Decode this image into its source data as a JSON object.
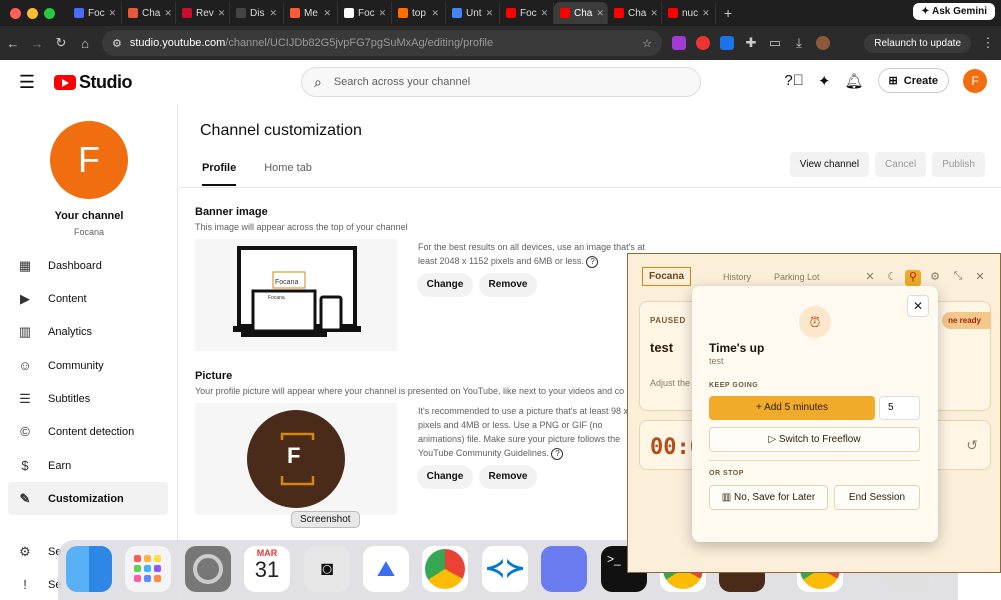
{
  "browser": {
    "tabs": [
      {
        "label": "Foc",
        "color": "#4a6cf7"
      },
      {
        "label": "Cha",
        "color": "#e8593a"
      },
      {
        "label": "Rev",
        "color": "#c8102e"
      },
      {
        "label": "Dis",
        "color": "#444444"
      },
      {
        "label": "Me",
        "color": "#ff5a36"
      },
      {
        "label": "Foc",
        "color": "#ffffff"
      },
      {
        "label": "top",
        "color": "#ff6f00"
      },
      {
        "label": "Unt",
        "color": "#4285f4"
      },
      {
        "label": "Foc",
        "color": "#ff0000"
      },
      {
        "label": "Cha",
        "color": "#ff0000"
      },
      {
        "label": "Cha",
        "color": "#ff0000"
      },
      {
        "label": "nuc",
        "color": "#ff0000"
      }
    ],
    "active_tab": 9,
    "new_tab_label": "+",
    "gemini_label": "Ask Gemini",
    "url_host": "studio.youtube.com",
    "url_path": "/channel/UCIJDb82G5jvpFG7pgSuMxAg/editing/profile",
    "relaunch_label": "Relaunch to update"
  },
  "header": {
    "studio_label": "Studio",
    "search_placeholder": "Search across your channel",
    "create_label": "Create",
    "avatar_letter": "F"
  },
  "sidebar": {
    "avatar_letter": "F",
    "title": "Your channel",
    "channel_name": "Focana",
    "items": [
      {
        "label": "Dashboard",
        "icon": "▦"
      },
      {
        "label": "Content",
        "icon": "▶"
      },
      {
        "label": "Analytics",
        "icon": "▥"
      },
      {
        "label": "Community",
        "icon": "☺"
      },
      {
        "label": "Subtitles",
        "icon": "☰"
      },
      {
        "label": "Content detection",
        "icon": "©"
      },
      {
        "label": "Earn",
        "icon": "$"
      },
      {
        "label": "Customization",
        "icon": "✎"
      }
    ],
    "bottom_items": [
      {
        "label": "Se",
        "icon": "⚙"
      },
      {
        "label": "Se",
        "icon": "!"
      }
    ]
  },
  "main": {
    "title": "Channel customization",
    "tabs": [
      "Profile",
      "Home tab"
    ],
    "view_channel": "View channel",
    "cancel": "Cancel",
    "publish": "Publish",
    "banner": {
      "title": "Banner image",
      "desc": "This image will appear across the top of your channel",
      "hint": "For the best results on all devices, use an image that's at least 2048 x 1152 pixels and 6MB or less.",
      "brand": "Focana",
      "change": "Change",
      "remove": "Remove"
    },
    "picture": {
      "title": "Picture",
      "desc": "Your profile picture will appear where your channel is presented on YouTube, like next to your videos and co",
      "hint": "It's recommended to use a picture that's at least 98 x pixels and 4MB or less. Use a PNG or GIF (no animations) file. Make sure your picture follows the YouTube Community Guidelines.",
      "letter": "F",
      "change": "Change",
      "remove": "Remove"
    }
  },
  "dock": {
    "tooltip": "Screenshot",
    "calendar_month": "MAR",
    "calendar_day": "31"
  },
  "focana": {
    "logo": "Focana",
    "nav": [
      "History",
      "Parking Lot"
    ],
    "paused_label": "PAUSED",
    "ready_label": "ne ready",
    "task": "test",
    "adjust_label": "Adjust the",
    "timer": "00:0",
    "modal": {
      "close": "✕",
      "title": "Time's up",
      "subtitle": "test",
      "keep_going": "KEEP GOING",
      "add_label": "+ Add 5 minutes",
      "minutes_value": "5",
      "freeflow_label": "Switch to Freeflow",
      "or_stop": "OR STOP",
      "save_later": "No, Save for Later",
      "end_session": "End Session"
    }
  }
}
